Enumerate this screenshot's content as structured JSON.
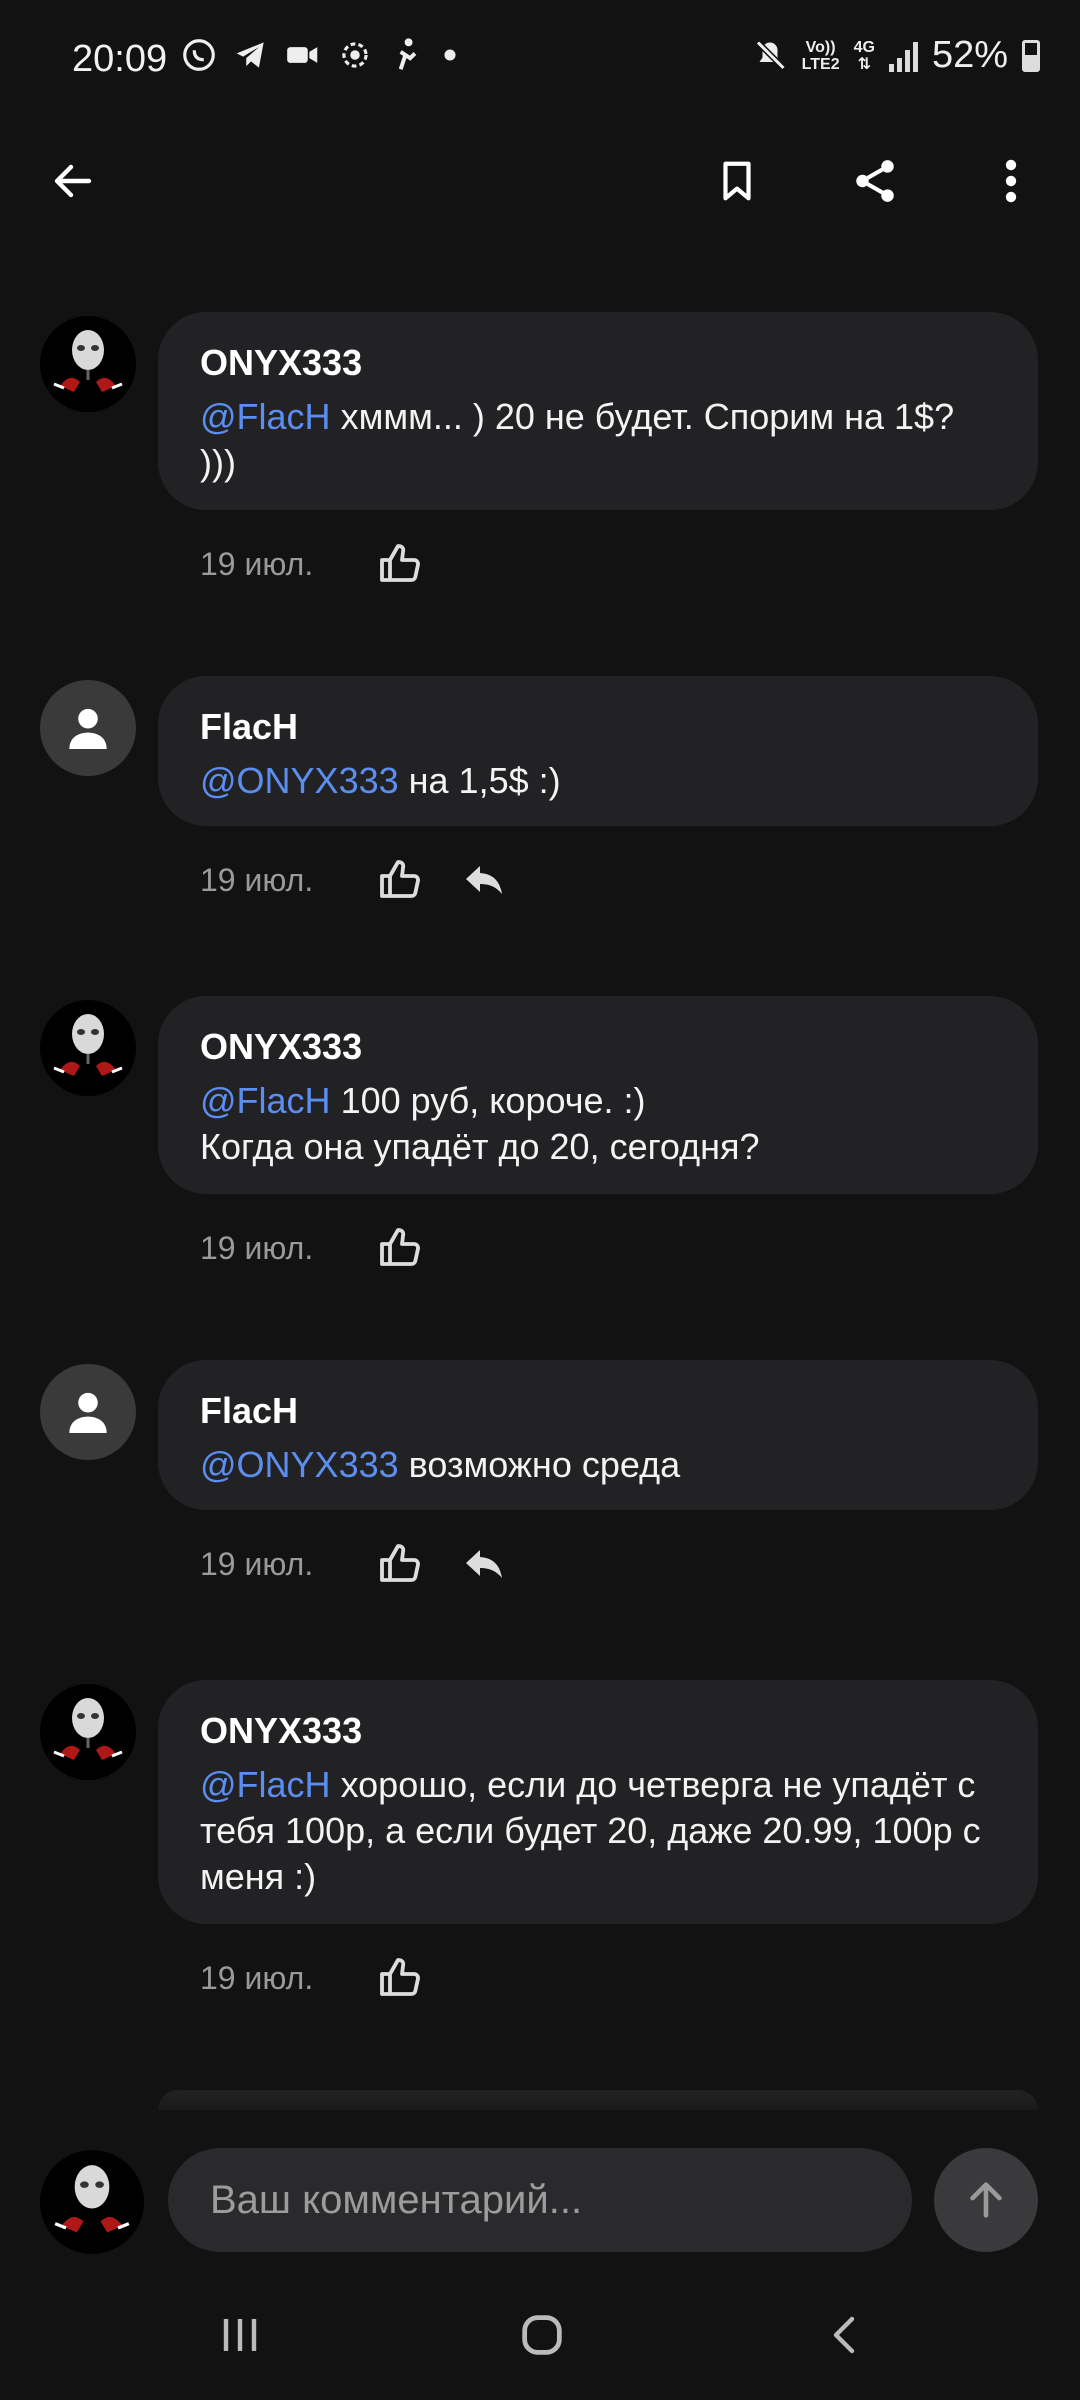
{
  "status_bar": {
    "time": "20:09",
    "network_top": "Vo))",
    "network_bottom": "LTE2",
    "net_type": "4G",
    "battery_percent": "52%",
    "battery_level": 0.52
  },
  "colors": {
    "background": "#121212",
    "bubble": "#222224",
    "mention": "#5b8ef0",
    "meta": "#9a9a9a"
  },
  "app_bar": {
    "icons": [
      "back-arrow-icon",
      "bookmark-icon",
      "share-icon",
      "more-vertical-icon"
    ]
  },
  "comments": [
    {
      "author": "ONYX333",
      "avatar": "mask-avatar",
      "mention": "@FlacH",
      "text": " хммм... ) 20 не будет. Спорим на 1$? )))",
      "date": "19 июл.",
      "reply": false
    },
    {
      "author": "FlacH",
      "avatar": "person-icon",
      "mention": "@ONYX333",
      "text": " на 1,5$ :)",
      "date": "19 июл.",
      "reply": true
    },
    {
      "author": "ONYX333",
      "avatar": "mask-avatar",
      "mention": "@FlacH",
      "text": " 100 руб, короче. :)\nКогда она упадёт до 20, сегодня?",
      "date": "19 июл.",
      "reply": false
    },
    {
      "author": "FlacH",
      "avatar": "person-icon",
      "mention": "@ONYX333",
      "text": " возможно среда",
      "date": "19 июл.",
      "reply": true
    },
    {
      "author": "ONYX333",
      "avatar": "mask-avatar",
      "mention": "@FlacH",
      "text": " хорошо, если до четверга не упадёт с тебя 100р, а если будет 20, даже 20.99, 100р с меня :)",
      "date": "19 июл.",
      "reply": false
    }
  ],
  "comment_input": {
    "placeholder": "Ваш комментарий..."
  },
  "nav_bar": {
    "icons": [
      "recent-apps-icon",
      "home-icon",
      "back-icon"
    ]
  }
}
